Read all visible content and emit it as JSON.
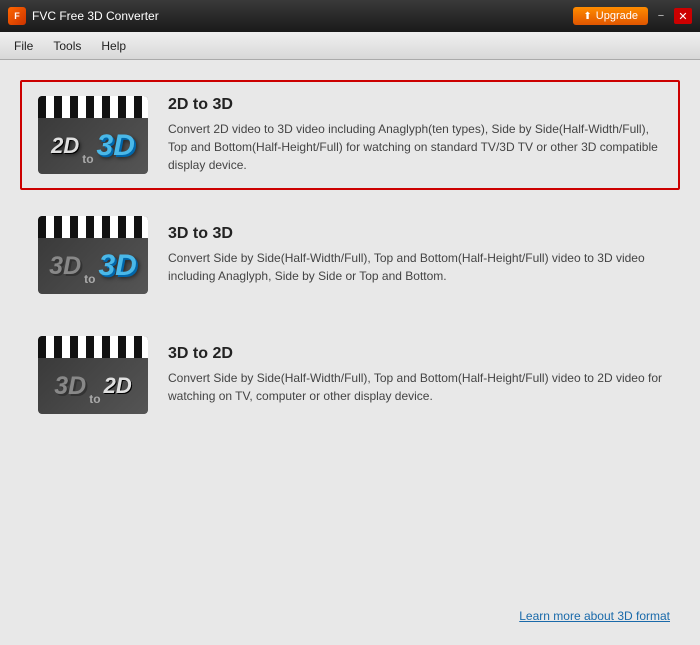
{
  "titleBar": {
    "appName": "FVC Free 3D Converter",
    "upgradeLabel": "Upgrade",
    "minimizeLabel": "−",
    "closeLabel": "✕"
  },
  "menuBar": {
    "items": [
      "File",
      "Tools",
      "Help"
    ]
  },
  "options": [
    {
      "id": "2d-to-3d",
      "title": "2D to 3D",
      "description": "Convert 2D video to 3D video including Anaglyph(ten types), Side by Side(Half-Width/Full), Top and Bottom(Half-Height/Full) for watching on standard TV/3D TV or other 3D compatible display device.",
      "selected": true,
      "iconType": "2d-to-3d"
    },
    {
      "id": "3d-to-3d",
      "title": "3D to 3D",
      "description": "Convert Side by Side(Half-Width/Full), Top and Bottom(Half-Height/Full) video to 3D video including Anaglyph, Side by Side or Top and Bottom.",
      "selected": false,
      "iconType": "3d-to-3d"
    },
    {
      "id": "3d-to-2d",
      "title": "3D to 2D",
      "description": "Convert Side by Side(Half-Width/Full), Top and Bottom(Half-Height/Full) video to 2D video for watching on TV, computer or other display device.",
      "selected": false,
      "iconType": "3d-to-2d"
    }
  ],
  "footer": {
    "linkText": "Learn more about 3D format"
  }
}
